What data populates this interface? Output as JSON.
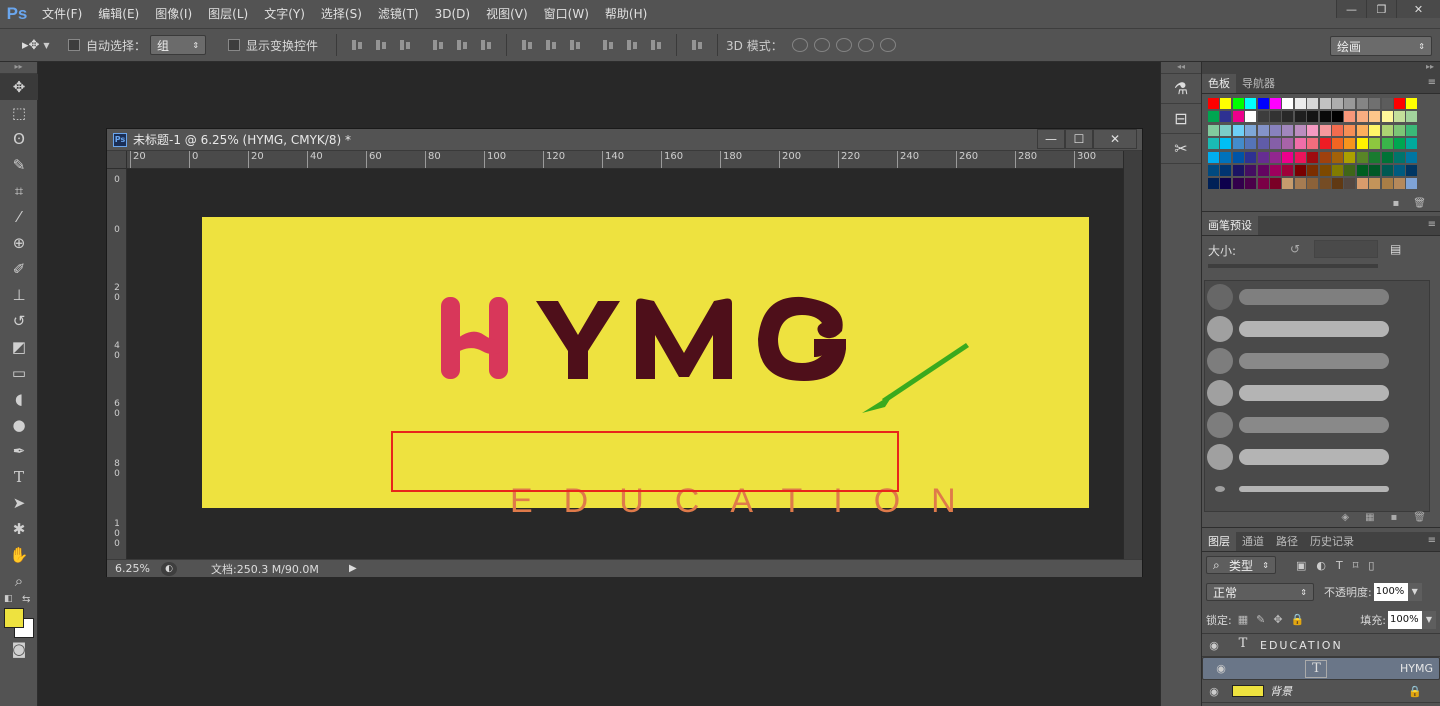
{
  "app": {
    "logo": "Ps"
  },
  "menu": [
    "文件(F)",
    "编辑(E)",
    "图像(I)",
    "图层(L)",
    "文字(Y)",
    "选择(S)",
    "滤镜(T)",
    "3D(D)",
    "视图(V)",
    "窗口(W)",
    "帮助(H)"
  ],
  "window_controls": {
    "minimize": "—",
    "restore": "❐",
    "close": "✕"
  },
  "options": {
    "auto_select_label": "自动选择：",
    "auto_select_value": "组",
    "show_transform_label": "显示变换控件",
    "mode_3d_label": "3D 模式：",
    "workspace": "绘画"
  },
  "document": {
    "title": "未标题-1 @ 6.25% (HYMG, CMYK/8) *",
    "zoom": "6.25%",
    "doc_info": "文档:250.3 M/90.0M",
    "h_ruler": [
      "20",
      "0",
      "20",
      "40",
      "60",
      "80",
      "100",
      "120",
      "140",
      "160",
      "180",
      "200",
      "220",
      "240",
      "260",
      "280",
      "300"
    ],
    "v_ruler": [
      "0",
      "0",
      "20",
      "40",
      "60",
      "80",
      "100"
    ]
  },
  "artwork": {
    "logo_text": "HYMG",
    "subtitle": "EDUCATION",
    "background_color": "#eee23f",
    "logo_h_color": "#d8375a",
    "logo_color": "#4e0f1a",
    "subtitle_color": "#df7a4a",
    "highlight_color": "#e8261a",
    "arrow_color": "#3aaa1e"
  },
  "panels": {
    "swatches": {
      "tabs": [
        "色板",
        "导航器"
      ]
    },
    "brush_presets": {
      "tab": "画笔预设",
      "size_label": "大小:"
    },
    "layers": {
      "tabs": [
        "图层",
        "通道",
        "路径",
        "历史记录"
      ],
      "filter_label": "类型",
      "blend_mode": "正常",
      "opacity_label": "不透明度:",
      "opacity_value": "100%",
      "lock_label": "锁定:",
      "fill_label": "填充:",
      "fill_value": "100%",
      "items": [
        {
          "name": "EDUCATION",
          "type": "T"
        },
        {
          "name": "HYMG",
          "type": "T"
        },
        {
          "name": "背景",
          "type": "bg"
        }
      ]
    }
  }
}
